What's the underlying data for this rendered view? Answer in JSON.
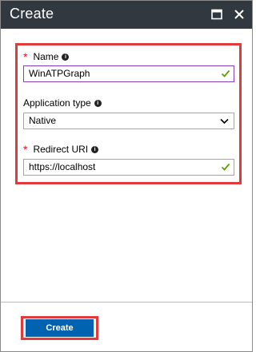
{
  "blade": {
    "title": "Create"
  },
  "form": {
    "name": {
      "required_mark": "*",
      "label": "Name",
      "value": "WinATPGraph"
    },
    "application_type": {
      "label": "Application type",
      "selected": "Native"
    },
    "redirect_uri": {
      "required_mark": "*",
      "label": "Redirect URI",
      "value": "https://localhost"
    },
    "info_glyph": "i"
  },
  "footer": {
    "create_label": "Create"
  },
  "colors": {
    "titlebar": "#32383f",
    "highlight": "#e03a3a",
    "primary_button": "#0063b1",
    "valid_check": "#57a300",
    "required": "#e81123"
  },
  "icons": [
    "maximize-icon",
    "close-icon",
    "info-icon",
    "checkmark-icon",
    "chevron-down-icon"
  ]
}
